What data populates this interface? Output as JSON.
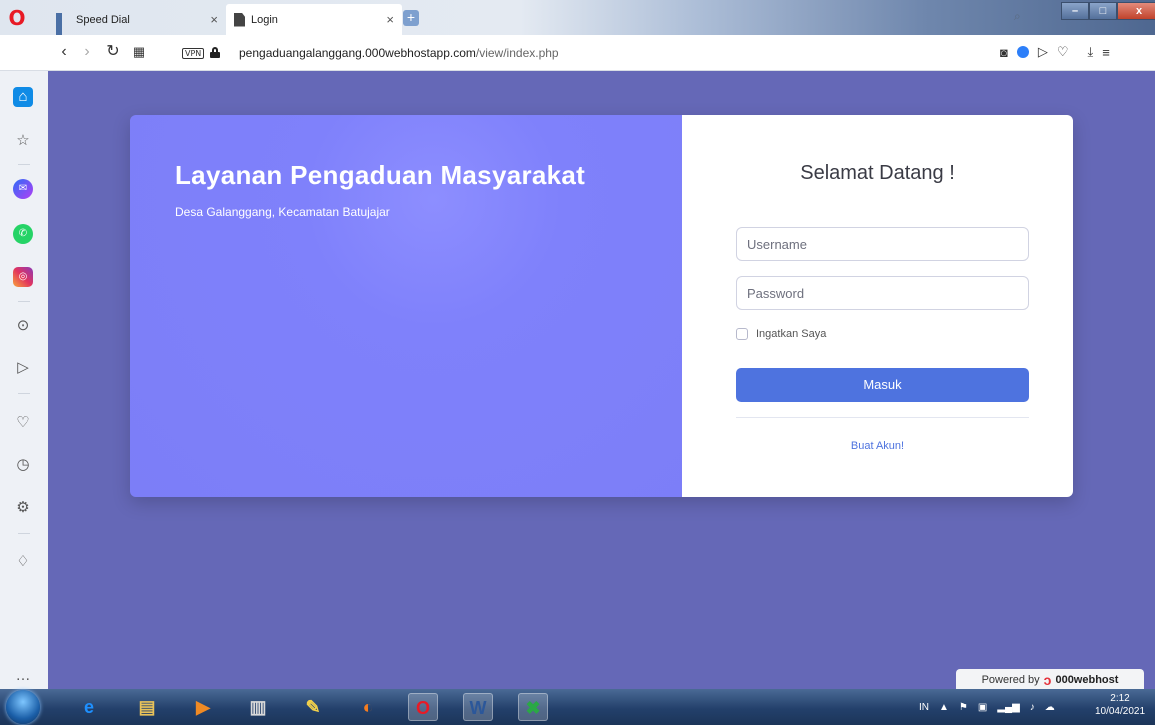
{
  "browser": {
    "tabs": [
      {
        "title": "Speed Dial",
        "active": false
      },
      {
        "title": "Login",
        "active": true
      }
    ],
    "close_glyph": "×",
    "new_tab_glyph": "+",
    "url_domain": "pengaduangalanggang.000webhostapp.com",
    "url_path": "/view/index.php",
    "vpn_label": "VPN",
    "window_controls": {
      "minimize": "–",
      "maximize": "□",
      "close": "x"
    }
  },
  "sidebar": {
    "items": [
      {
        "name": "home-icon",
        "glyph": "⌂"
      },
      {
        "name": "star-icon",
        "glyph": "☆"
      },
      {
        "name": "messenger-icon",
        "glyph": "✉"
      },
      {
        "name": "whatsapp-icon",
        "glyph": "✆"
      },
      {
        "name": "instagram-icon",
        "glyph": "◎"
      },
      {
        "name": "player-icon",
        "glyph": "⊙"
      },
      {
        "name": "send-icon",
        "glyph": "▷"
      },
      {
        "name": "heart-icon",
        "glyph": "♡"
      },
      {
        "name": "history-icon",
        "glyph": "◷"
      },
      {
        "name": "settings-icon",
        "glyph": "⚙"
      },
      {
        "name": "bulb-icon",
        "glyph": "♢"
      }
    ],
    "more_glyph": "…"
  },
  "hero": {
    "title": "Layanan Pengaduan Masyarakat",
    "subtitle": "Desa Galanggang, Kecamatan Batujajar"
  },
  "login": {
    "heading": "Selamat Datang !",
    "username_placeholder": "Username",
    "password_placeholder": "Password",
    "remember_label": "Ingatkan Saya",
    "submit_label": "Masuk",
    "create_account_label": "Buat Akun!"
  },
  "powered": {
    "prefix": "Powered by",
    "host_name": "000webhost"
  },
  "taskbar": {
    "apps": [
      {
        "name": "ie-icon",
        "glyph": "e",
        "color": "#1e90ff"
      },
      {
        "name": "explorer-icon",
        "glyph": "▤",
        "color": "#e8c25a"
      },
      {
        "name": "media-player-icon",
        "glyph": "▶",
        "color": "#f08a24"
      },
      {
        "name": "archive-icon",
        "glyph": "▥",
        "color": "#d9d9d9"
      },
      {
        "name": "tools-icon",
        "glyph": "✎",
        "color": "#f2d04b"
      },
      {
        "name": "uc-browser-icon",
        "glyph": "◐",
        "color": "#f57c1f"
      },
      {
        "name": "opera-icon",
        "glyph": "O",
        "color": "#e81a25"
      },
      {
        "name": "word-icon",
        "glyph": "W",
        "color": "#2b579a"
      },
      {
        "name": "excel-tool-icon",
        "glyph": "✖",
        "color": "#2aa845"
      }
    ],
    "language": "IN",
    "time": "2:12",
    "date": "10/04/2021"
  },
  "colors": {
    "page_bg": "#6568b7",
    "hero_bg": "#7c7ef7",
    "button_primary": "#4e73df",
    "link": "#4e73df"
  }
}
